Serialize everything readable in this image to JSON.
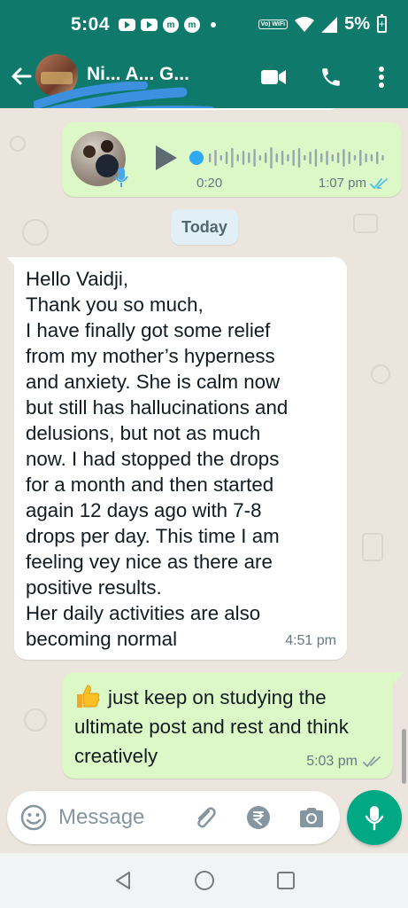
{
  "status_bar": {
    "time": "5:04",
    "notif_icons": [
      "youtube-icon",
      "youtube-icon",
      "m-icon",
      "m-icon"
    ],
    "vowifi_label": "Vo) WiFi",
    "battery_percent": "5%"
  },
  "header": {
    "contact_name": "Ni... A... G...",
    "icons": [
      "back-arrow-icon",
      "video-call-icon",
      "phone-icon",
      "more-vert-icon"
    ]
  },
  "chat": {
    "voice_note": {
      "duration": "0:20",
      "time": "1:07 pm",
      "status": "read"
    },
    "date_chip": "Today",
    "incoming": {
      "text": "Hello Vaidji,\nThank you so much,\nI have finally got some relief\nfrom my mother’s hyperness\nand anxiety. She is calm now\nbut still has hallucinations and\ndelusions, but not as much\nnow. I had stopped the drops\nfor a month and then started\nagain 12 days ago with 7-8\ndrops per day. This time I am\nfeeling vey nice as there are\npositive results.\nHer daily activities are also\nbecoming normal",
      "time": "4:51 pm"
    },
    "outgoing": {
      "text": "just keep on studying the ultimate post and rest and think creatively",
      "emoji": "thumbs-up",
      "time": "5:03 pm",
      "status": "delivered"
    }
  },
  "composer": {
    "placeholder": "Message",
    "icons": [
      "emoji-icon",
      "attach-icon",
      "rupee-icon",
      "camera-icon",
      "mic-icon"
    ]
  },
  "colors": {
    "header": "#0f7a6b",
    "outgoing_bubble": "#dcf8c6",
    "incoming_bubble": "#ffffff",
    "chat_bg": "#ece5dd",
    "mic_button": "#00a884",
    "read_ticks": "#53bdeb"
  }
}
